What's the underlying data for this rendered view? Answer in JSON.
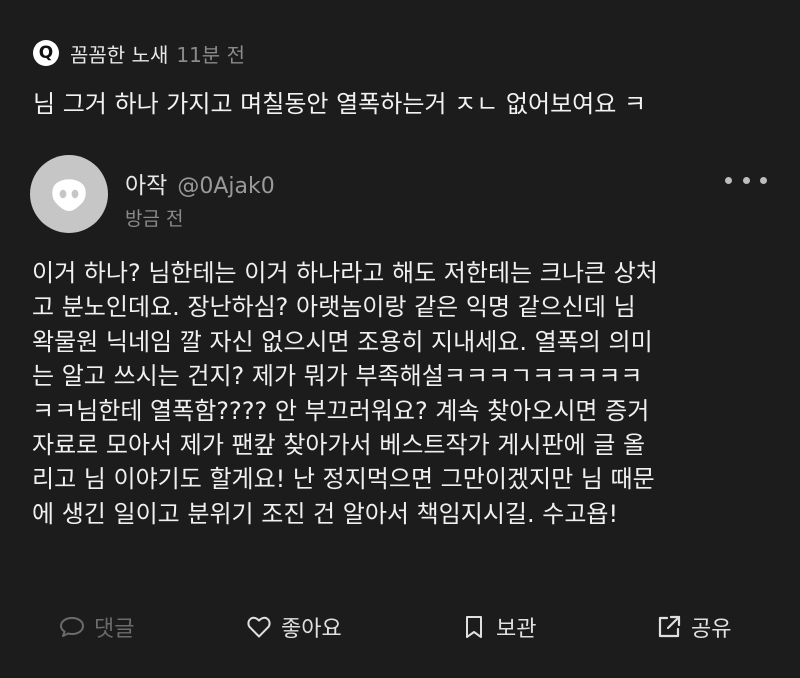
{
  "question": {
    "badge": "Q",
    "author": "꼼꼼한 노새",
    "time": "11분 전",
    "text": "님 그거 하나 가지고 며칠동안 열폭하는거 ㅈㄴ 없어보여요 ㅋ"
  },
  "answer": {
    "author_name": "아작",
    "author_handle": "@0Ajak0",
    "time": "방금 전",
    "body_lines": [
      "이거 하나? 님한테는 이거 하나라고 해도 저한테는 크나큰 상처",
      "고 분노인데요. 장난하심? 아랫놈이랑 같은 익명 같으신데 님",
      "왁물원 닉네임 깔 자신 없으시면 조용히 지내세요. 열폭의 의미",
      "는 알고 쓰시는 건지? 제가 뭐가 부족해설ㅋㅋㅋㄱㅋㅋㅋㅋㅋ",
      "ㅋㅋ님한테 열폭함???? 안 부끄러워요? 계속 찾아오시면 증거",
      "자료로 모아서 제가 팬캎 찾아가서 베스트작가 게시판에 글 올",
      "리고 님 이야기도 할게요! 난 정지먹으면 그만이겠지만 님 때문",
      "에 생긴 일이고 분위기 조진 건 알아서 책임지시길. 수고욥!"
    ]
  },
  "actions": {
    "comment": "댓글",
    "like": "좋아요",
    "save": "보관",
    "share": "공유"
  },
  "colors": {
    "background": "#1c1c1c",
    "text": "#f0f0f0",
    "muted": "#8a8a8a",
    "disabled": "#6b6b6b",
    "avatar_bg": "#c6c6c6"
  },
  "icons": {
    "question_badge": "q-badge",
    "avatar": "avatar-icon",
    "more": "more-icon",
    "comment": "comment-icon",
    "like": "heart-icon",
    "save": "bookmark-icon",
    "share": "share-icon"
  }
}
